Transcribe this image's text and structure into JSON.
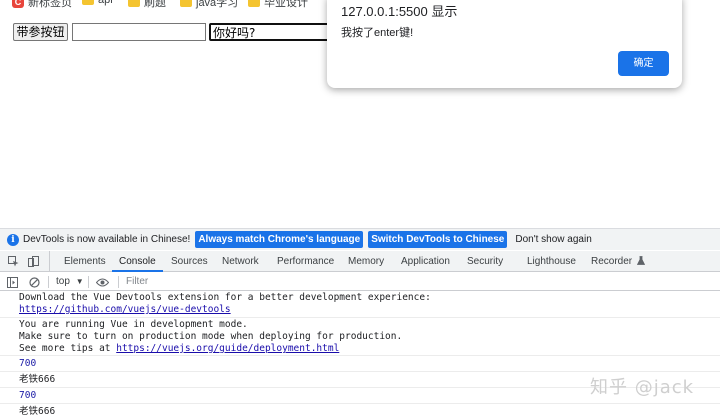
{
  "bookmarks": [
    "新标签页",
    "api",
    "刷题",
    "java学习",
    "毕业设计"
  ],
  "page": {
    "button_label": "带参按钮",
    "input1_value": "",
    "input2_value": "你好吗?"
  },
  "alert": {
    "title": "127.0.0.1:5500 显示",
    "message": "我按了enter键!",
    "ok_label": "确定"
  },
  "devtools": {
    "infobar": {
      "text": "DevTools is now available in Chinese!",
      "btn_match": "Always match Chrome's language",
      "btn_switch": "Switch DevTools to Chinese",
      "btn_dismiss": "Don't show again"
    },
    "tabs": [
      "Elements",
      "Console",
      "Sources",
      "Network",
      "Performance",
      "Memory",
      "Application",
      "Security",
      "Lighthouse",
      "Recorder"
    ],
    "active_tab": "Console",
    "context": "top",
    "filter_placeholder": "Filter"
  },
  "console": {
    "line1": "Download the Vue Devtools extension for a better development experience:",
    "link1": "https://github.com/vuejs/vue-devtools",
    "line2": "You are running Vue in development mode.",
    "line3": "Make sure to turn on production mode when deploying for production.",
    "line4_prefix": "See more tips at ",
    "link2": "https://vuejs.org/guide/deployment.html",
    "out1": "700",
    "out2": "老铁666",
    "out3": "700",
    "out4": "老铁666"
  },
  "watermark": "知乎 @jack",
  "colors": {
    "accent": "#1a73e8",
    "link": "#1a0dab"
  }
}
